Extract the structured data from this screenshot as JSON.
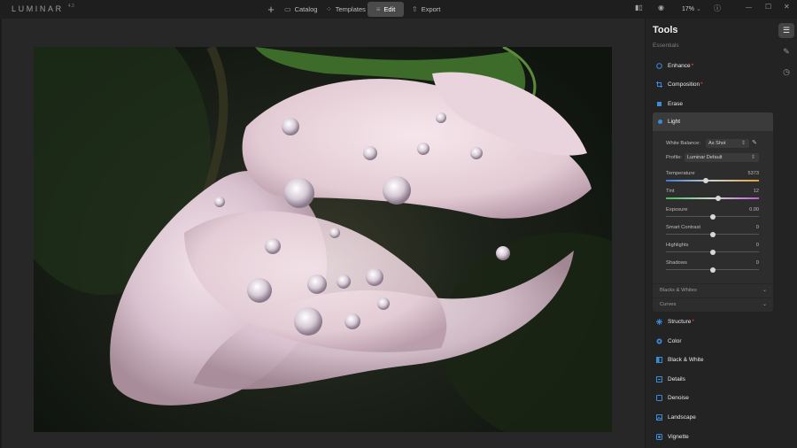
{
  "app": {
    "logo": "LUMINAR",
    "version": "4.3"
  },
  "nav": {
    "plus": "+",
    "catalog": "Catalog",
    "templates": "Templates",
    "edit": "Edit",
    "export": "Export"
  },
  "topright": {
    "zoom": "17%",
    "zoom_arrow": "⌄"
  },
  "window": {
    "minimize": "—",
    "maximize": "☐",
    "close": "✕"
  },
  "panel": {
    "title": "Tools",
    "section": "Essentials",
    "tools_above": [
      {
        "label": "Enhance",
        "modified": "*"
      },
      {
        "label": "Composition",
        "modified": "*"
      },
      {
        "label": "Erase",
        "modified": ""
      }
    ],
    "light": {
      "label": "Light",
      "white_balance_label": "White Balance:",
      "white_balance_value": "As Shot",
      "profile_label": "Profile:",
      "profile_value": "Luminar Default",
      "sliders": [
        {
          "label": "Temperature",
          "value": "5373",
          "level": 0.43
        },
        {
          "label": "Tint",
          "value": "12",
          "level": 0.56
        },
        {
          "label": "Exposure",
          "value": "0.00",
          "level": 0.5
        },
        {
          "label": "Smart Contrast",
          "value": "0",
          "level": 0.5
        },
        {
          "label": "Highlights",
          "value": "0",
          "level": 0.5
        },
        {
          "label": "Shadows",
          "value": "0",
          "level": 0.5
        }
      ],
      "sub_sections": [
        "Blacks & Whites",
        "Curves"
      ]
    },
    "tools_below": [
      {
        "label": "Structure",
        "modified": "*"
      },
      {
        "label": "Color",
        "modified": ""
      },
      {
        "label": "Black & White",
        "modified": ""
      },
      {
        "label": "Details",
        "modified": ""
      },
      {
        "label": "Denoise",
        "modified": ""
      },
      {
        "label": "Landscape",
        "modified": ""
      },
      {
        "label": "Vignette",
        "modified": ""
      }
    ]
  },
  "colors": {
    "accent": "#3b8bd8",
    "modified_star": "#f05c2c",
    "panel_bg": "#232323"
  }
}
